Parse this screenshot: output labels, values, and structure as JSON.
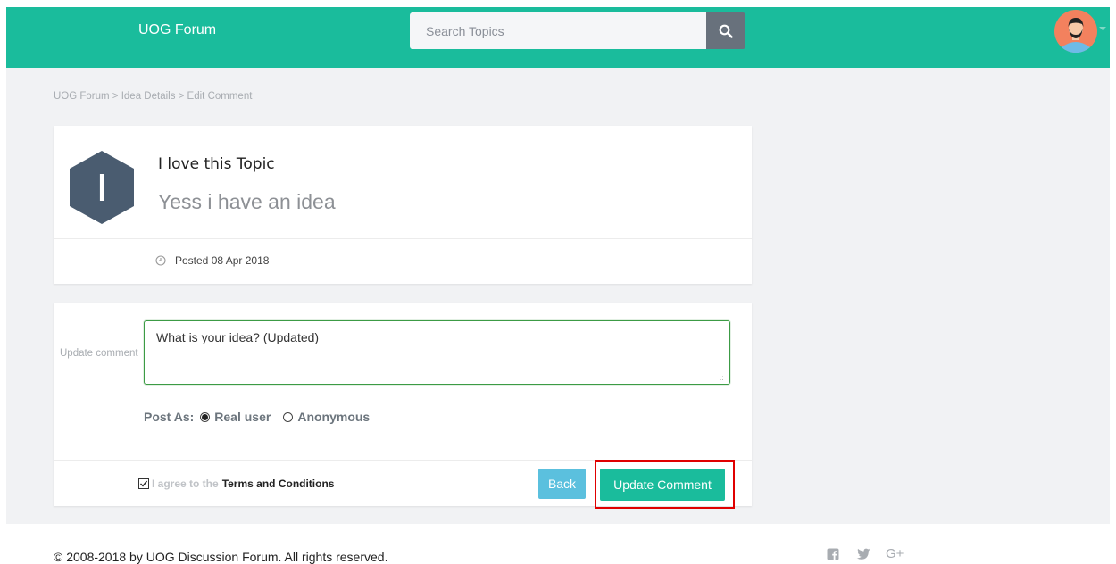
{
  "header": {
    "brand": "UOG Forum",
    "search_placeholder": "Search Topics"
  },
  "breadcrumb": "UOG Forum > Idea Details > Edit Comment",
  "topic": {
    "title": "I love this Topic",
    "subtitle": "Yess i have an idea",
    "avatar_letter": "I",
    "posted": "Posted 08 Apr 2018"
  },
  "form": {
    "label": "Update comment",
    "comment_value": "What is your idea? (Updated)",
    "post_as_label": "Post As:",
    "options": [
      {
        "label": "Real user",
        "selected": true
      },
      {
        "label": "Anonymous",
        "selected": false
      }
    ],
    "agree_text": "I agree to the",
    "terms_link": "Terms and Conditions",
    "agree_checked": true,
    "back_label": "Back",
    "update_label": "Update Comment"
  },
  "footer": {
    "copyright": "© 2008-2018 by UOG Discussion Forum. All rights reserved.",
    "social": [
      "facebook-icon",
      "twitter-icon",
      "google-plus-icon"
    ],
    "gplus_text": "G+"
  },
  "colors": {
    "accent": "#1abc9c",
    "info": "#5bc0de",
    "highlight": "#e00000"
  }
}
